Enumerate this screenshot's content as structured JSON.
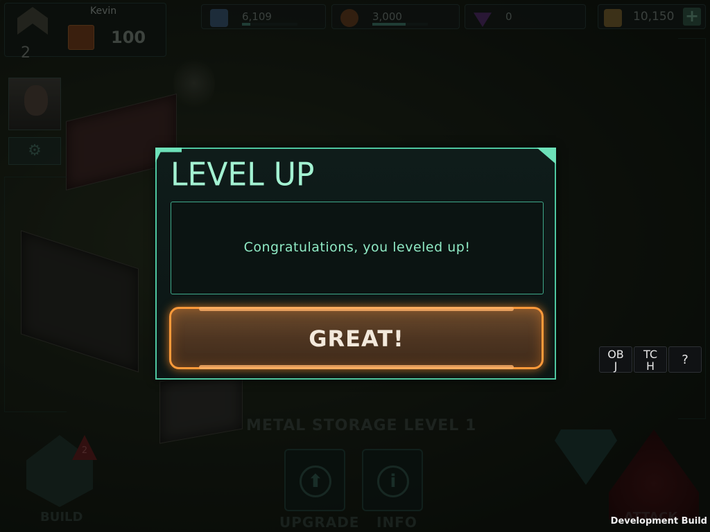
{
  "player": {
    "name": "Kevin",
    "rank": "2",
    "power": "100"
  },
  "resources": {
    "metal": {
      "value": "6,109",
      "icon": "metal-icon",
      "fill_fraction": 0.15
    },
    "oil": {
      "value": "3,000",
      "icon": "oil-icon",
      "fill_fraction": 0.6
    },
    "crystal": {
      "value": "0",
      "icon": "crystal-icon"
    },
    "gold": {
      "value": "10,150",
      "icon": "gold-icon",
      "add_label": "+"
    }
  },
  "hud": {
    "settings_icon": "⚙",
    "building_title": "METAL STORAGE LEVEL 1",
    "upgrade_label": "UPGRADE",
    "info_label": "INFO",
    "build_label": "BUILD",
    "build_badge": "2",
    "attack_label": "ATTACK",
    "upgrade_icon": "⬆",
    "info_icon": "i"
  },
  "debug": {
    "obj": "OB\nJ",
    "tch": "TC\nH",
    "help": "?",
    "dev_build": "Development Build"
  },
  "dialog": {
    "title": "LEVEL UP",
    "message": "Congratulations, you leveled up!",
    "confirm_label": "GREAT!"
  },
  "colors": {
    "dialog_border": "#4ec7a0",
    "title_text": "#a3f2d2",
    "button_glow": "#ff9a3a"
  }
}
